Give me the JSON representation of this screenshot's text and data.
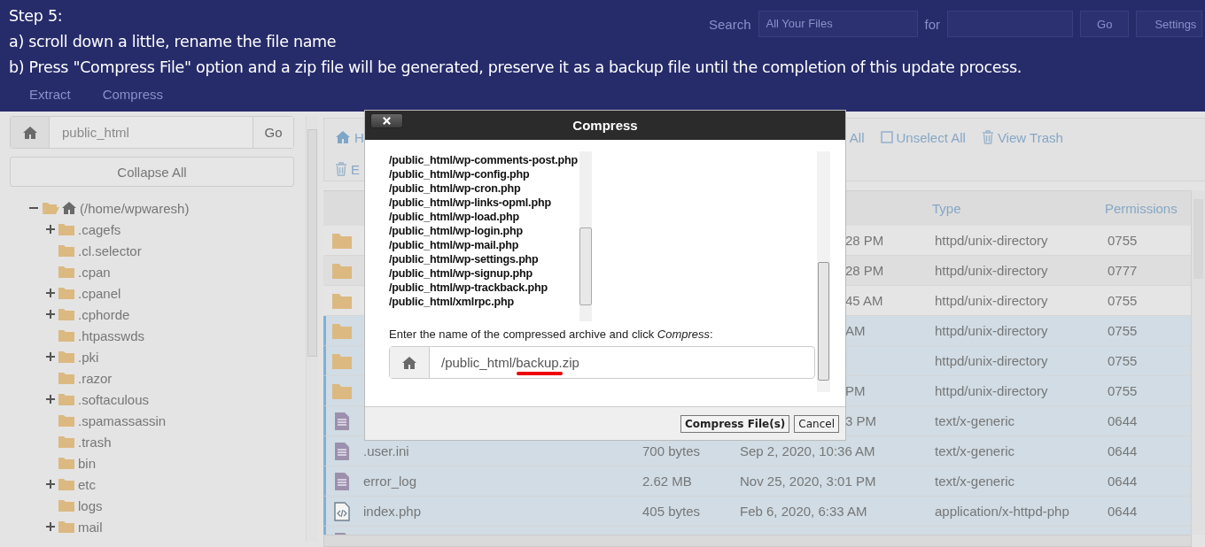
{
  "banner": {
    "title": "Step 5:",
    "lines": [
      "a) scroll down a little, rename  the file name",
      "b) Press \"Compress File\" option and a zip file will be generated, preserve it as a backup file until the completion of this update process."
    ]
  },
  "header": {
    "search_label": "Search",
    "scope": "All Your Files",
    "for_label": "for",
    "go": "Go",
    "settings": "Settings",
    "actions": [
      "Extract",
      "Compress"
    ]
  },
  "sidebar": {
    "path": "public_html",
    "go": "Go",
    "collapse": "Collapse All",
    "tree": {
      "label": "(/home/wpwaresh)",
      "expanded": true,
      "children": [
        {
          "label": ".cagefs",
          "expandable": true
        },
        {
          "label": ".cl.selector",
          "expandable": false
        },
        {
          "label": ".cpan",
          "expandable": false
        },
        {
          "label": ".cpanel",
          "expandable": true
        },
        {
          "label": ".cphorde",
          "expandable": true
        },
        {
          "label": ".htpasswds",
          "expandable": false
        },
        {
          "label": ".pki",
          "expandable": true
        },
        {
          "label": ".razor",
          "expandable": false
        },
        {
          "label": ".softaculous",
          "expandable": true
        },
        {
          "label": ".spamassassin",
          "expandable": false
        },
        {
          "label": ".trash",
          "expandable": false
        },
        {
          "label": "bin",
          "expandable": false
        },
        {
          "label": "etc",
          "expandable": true
        },
        {
          "label": "logs",
          "expandable": false
        },
        {
          "label": "mail",
          "expandable": true
        }
      ]
    }
  },
  "toolbar": [
    [
      {
        "label": "H",
        "kind": "home"
      },
      {
        "label": "All",
        "kind": "plain"
      },
      {
        "label": "Unselect All",
        "kind": "checkbox"
      },
      {
        "label": "View Trash",
        "kind": "trash"
      }
    ],
    [
      {
        "label": "E",
        "kind": "trash"
      }
    ]
  ],
  "table": {
    "columns": [
      "Type",
      "Permissions"
    ],
    "rows": [
      {
        "kind": "folder",
        "selected": false,
        "modified": "28 PM",
        "type": "httpd/unix-directory",
        "permissions": "0755"
      },
      {
        "kind": "folder",
        "selected": false,
        "modified": "28 PM",
        "type": "httpd/unix-directory",
        "permissions": "0777"
      },
      {
        "kind": "folder",
        "selected": false,
        "modified": "45 AM",
        "type": "httpd/unix-directory",
        "permissions": "0755"
      },
      {
        "kind": "folder",
        "selected": true,
        "modified": "AM",
        "type": "httpd/unix-directory",
        "permissions": "0755"
      },
      {
        "kind": "folder",
        "selected": true,
        "type": "httpd/unix-directory",
        "permissions": "0755"
      },
      {
        "kind": "folder",
        "selected": true,
        "modified": "PM",
        "type": "httpd/unix-directory",
        "permissions": "0755"
      },
      {
        "kind": "text",
        "selected": true,
        "modified": "3 PM",
        "type": "text/x-generic",
        "permissions": "0644"
      },
      {
        "kind": "text",
        "selected": true,
        "name": ".user.ini",
        "size": "700 bytes",
        "modified": "Sep 2, 2020, 10:36 AM",
        "type": "text/x-generic",
        "permissions": "0644"
      },
      {
        "kind": "text",
        "selected": true,
        "name": "error_log",
        "size": "2.62 MB",
        "modified": "Nov 25, 2020, 3:01 PM",
        "type": "text/x-generic",
        "permissions": "0644"
      },
      {
        "kind": "code",
        "selected": true,
        "name": "index.php",
        "size": "405 bytes",
        "modified": "Feb 6, 2020, 6:33 AM",
        "type": "application/x-httpd-php",
        "permissions": "0644"
      },
      {
        "kind": "text",
        "selected": true
      }
    ]
  },
  "dialog": {
    "title": "Compress",
    "files": [
      "/public_html/wp-comments-post.php",
      "/public_html/wp-config.php",
      "/public_html/wp-cron.php",
      "/public_html/wp-links-opml.php",
      "/public_html/wp-load.php",
      "/public_html/wp-login.php",
      "/public_html/wp-mail.php",
      "/public_html/wp-settings.php",
      "/public_html/wp-signup.php",
      "/public_html/wp-trackback.php",
      "/public_html/xmlrpc.php"
    ],
    "prompt": "Enter the name of the compressed archive and click *Compress*:",
    "archive": "/public_html/backup.zip",
    "buttons": [
      "Compress File(s)",
      "Cancel"
    ]
  }
}
